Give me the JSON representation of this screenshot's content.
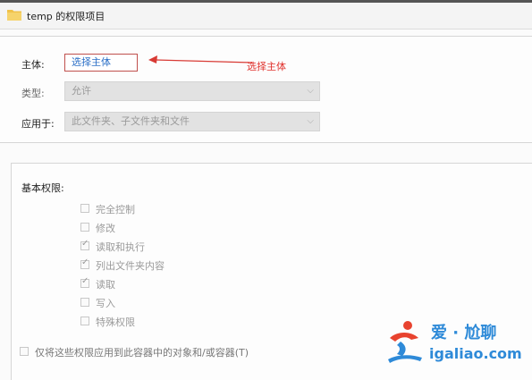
{
  "window": {
    "title": "temp 的权限项目"
  },
  "principal": {
    "label": "主体:",
    "link_text": "选择主体"
  },
  "annotation": {
    "text": "选择主体",
    "color": "#e0302b"
  },
  "type": {
    "label": "类型:",
    "value": "允许"
  },
  "applies_to": {
    "label": "应用于:",
    "value": "此文件夹、子文件夹和文件"
  },
  "basic_permissions": {
    "title": "基本权限:",
    "items": [
      {
        "label": "完全控制",
        "checked": false
      },
      {
        "label": "修改",
        "checked": false
      },
      {
        "label": "读取和执行",
        "checked": true
      },
      {
        "label": "列出文件夹内容",
        "checked": true
      },
      {
        "label": "读取",
        "checked": true
      },
      {
        "label": "写入",
        "checked": false
      },
      {
        "label": "特殊权限",
        "checked": false
      }
    ]
  },
  "apply_only": {
    "label": "仅将这些权限应用到此容器中的对象和/或容器(T)",
    "checked": false
  },
  "watermark": {
    "line1": "爱 · 尬聊",
    "line2": "igaliao.com"
  },
  "colors": {
    "accent_link": "#2b6fc7",
    "highlight_box": "#c0504d",
    "watermark": "#2e8ad8"
  }
}
